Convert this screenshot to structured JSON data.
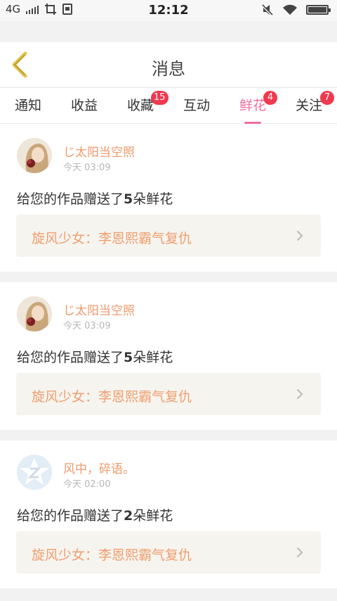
{
  "status_bar": {
    "network": "4G",
    "time": "12:12"
  },
  "header": {
    "title": "消息"
  },
  "tabs": [
    {
      "label": "通知",
      "badge": ""
    },
    {
      "label": "收益",
      "badge": ""
    },
    {
      "label": "收藏",
      "badge": "15"
    },
    {
      "label": "互动",
      "badge": ""
    },
    {
      "label": "鲜花",
      "badge": "4",
      "active": true
    },
    {
      "label": "关注",
      "badge": "7"
    }
  ],
  "cards": [
    {
      "user": "じ太阳当空照",
      "time": "今天 03:09",
      "message_prefix": "给您的作品赠送了",
      "count": "5",
      "message_suffix": "朵鲜花",
      "work": "旋风少女：李恩熙霸气复仇"
    },
    {
      "user": "じ太阳当空照",
      "time": "今天 03:09",
      "message_prefix": "给您的作品赠送了",
      "count": "5",
      "message_suffix": "朵鲜花",
      "work": "旋风少女：李恩熙霸气复仇"
    },
    {
      "user": "风中，碎语。",
      "time": "今天 02:00",
      "message_prefix": "给您的作品赠送了",
      "count": "2",
      "message_suffix": "朵鲜花",
      "work": "旋风少女：李恩熙霸气复仇"
    }
  ],
  "colors": {
    "accent": "#ef6fa0",
    "username": "#ee9a6b",
    "badge": "#f0394e",
    "back_arrow": "#e2c34a"
  }
}
